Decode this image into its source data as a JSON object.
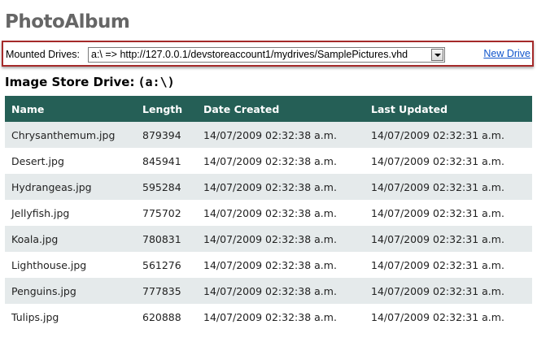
{
  "app": {
    "title": "PhotoAlbum"
  },
  "drive_bar": {
    "label": "Mounted Drives:",
    "selected_drive": "a:\\ => http://127.0.0.1/devstoreaccount1/mydrives/SamplePictures.vhd",
    "new_drive_label": "New Drive"
  },
  "section": {
    "title": "Image Store Drive:",
    "drive": "(a:\\)"
  },
  "table": {
    "columns": [
      "Name",
      "Length",
      "Date Created",
      "Last Updated"
    ],
    "rows": [
      {
        "name": "Chrysanthemum.jpg",
        "length": "879394",
        "created": "14/07/2009 02:32:38 a.m.",
        "updated": "14/07/2009 02:32:31 a.m."
      },
      {
        "name": "Desert.jpg",
        "length": "845941",
        "created": "14/07/2009 02:32:38 a.m.",
        "updated": "14/07/2009 02:32:31 a.m."
      },
      {
        "name": "Hydrangeas.jpg",
        "length": "595284",
        "created": "14/07/2009 02:32:38 a.m.",
        "updated": "14/07/2009 02:32:31 a.m."
      },
      {
        "name": "Jellyfish.jpg",
        "length": "775702",
        "created": "14/07/2009 02:32:38 a.m.",
        "updated": "14/07/2009 02:32:31 a.m."
      },
      {
        "name": "Koala.jpg",
        "length": "780831",
        "created": "14/07/2009 02:32:38 a.m.",
        "updated": "14/07/2009 02:32:31 a.m."
      },
      {
        "name": "Lighthouse.jpg",
        "length": "561276",
        "created": "14/07/2009 02:32:38 a.m.",
        "updated": "14/07/2009 02:32:31 a.m."
      },
      {
        "name": "Penguins.jpg",
        "length": "777835",
        "created": "14/07/2009 02:32:38 a.m.",
        "updated": "14/07/2009 02:32:31 a.m."
      },
      {
        "name": "Tulips.jpg",
        "length": "620888",
        "created": "14/07/2009 02:32:38 a.m.",
        "updated": "14/07/2009 02:32:31 a.m."
      }
    ]
  },
  "colors": {
    "header_bg": "#255f56",
    "alt_row_bg": "#e5eaeb",
    "title_color": "#666666",
    "highlight_border": "#a52a2a",
    "link_color": "#1155cc"
  },
  "icons": {
    "dropdown": "chevron-down-icon"
  }
}
